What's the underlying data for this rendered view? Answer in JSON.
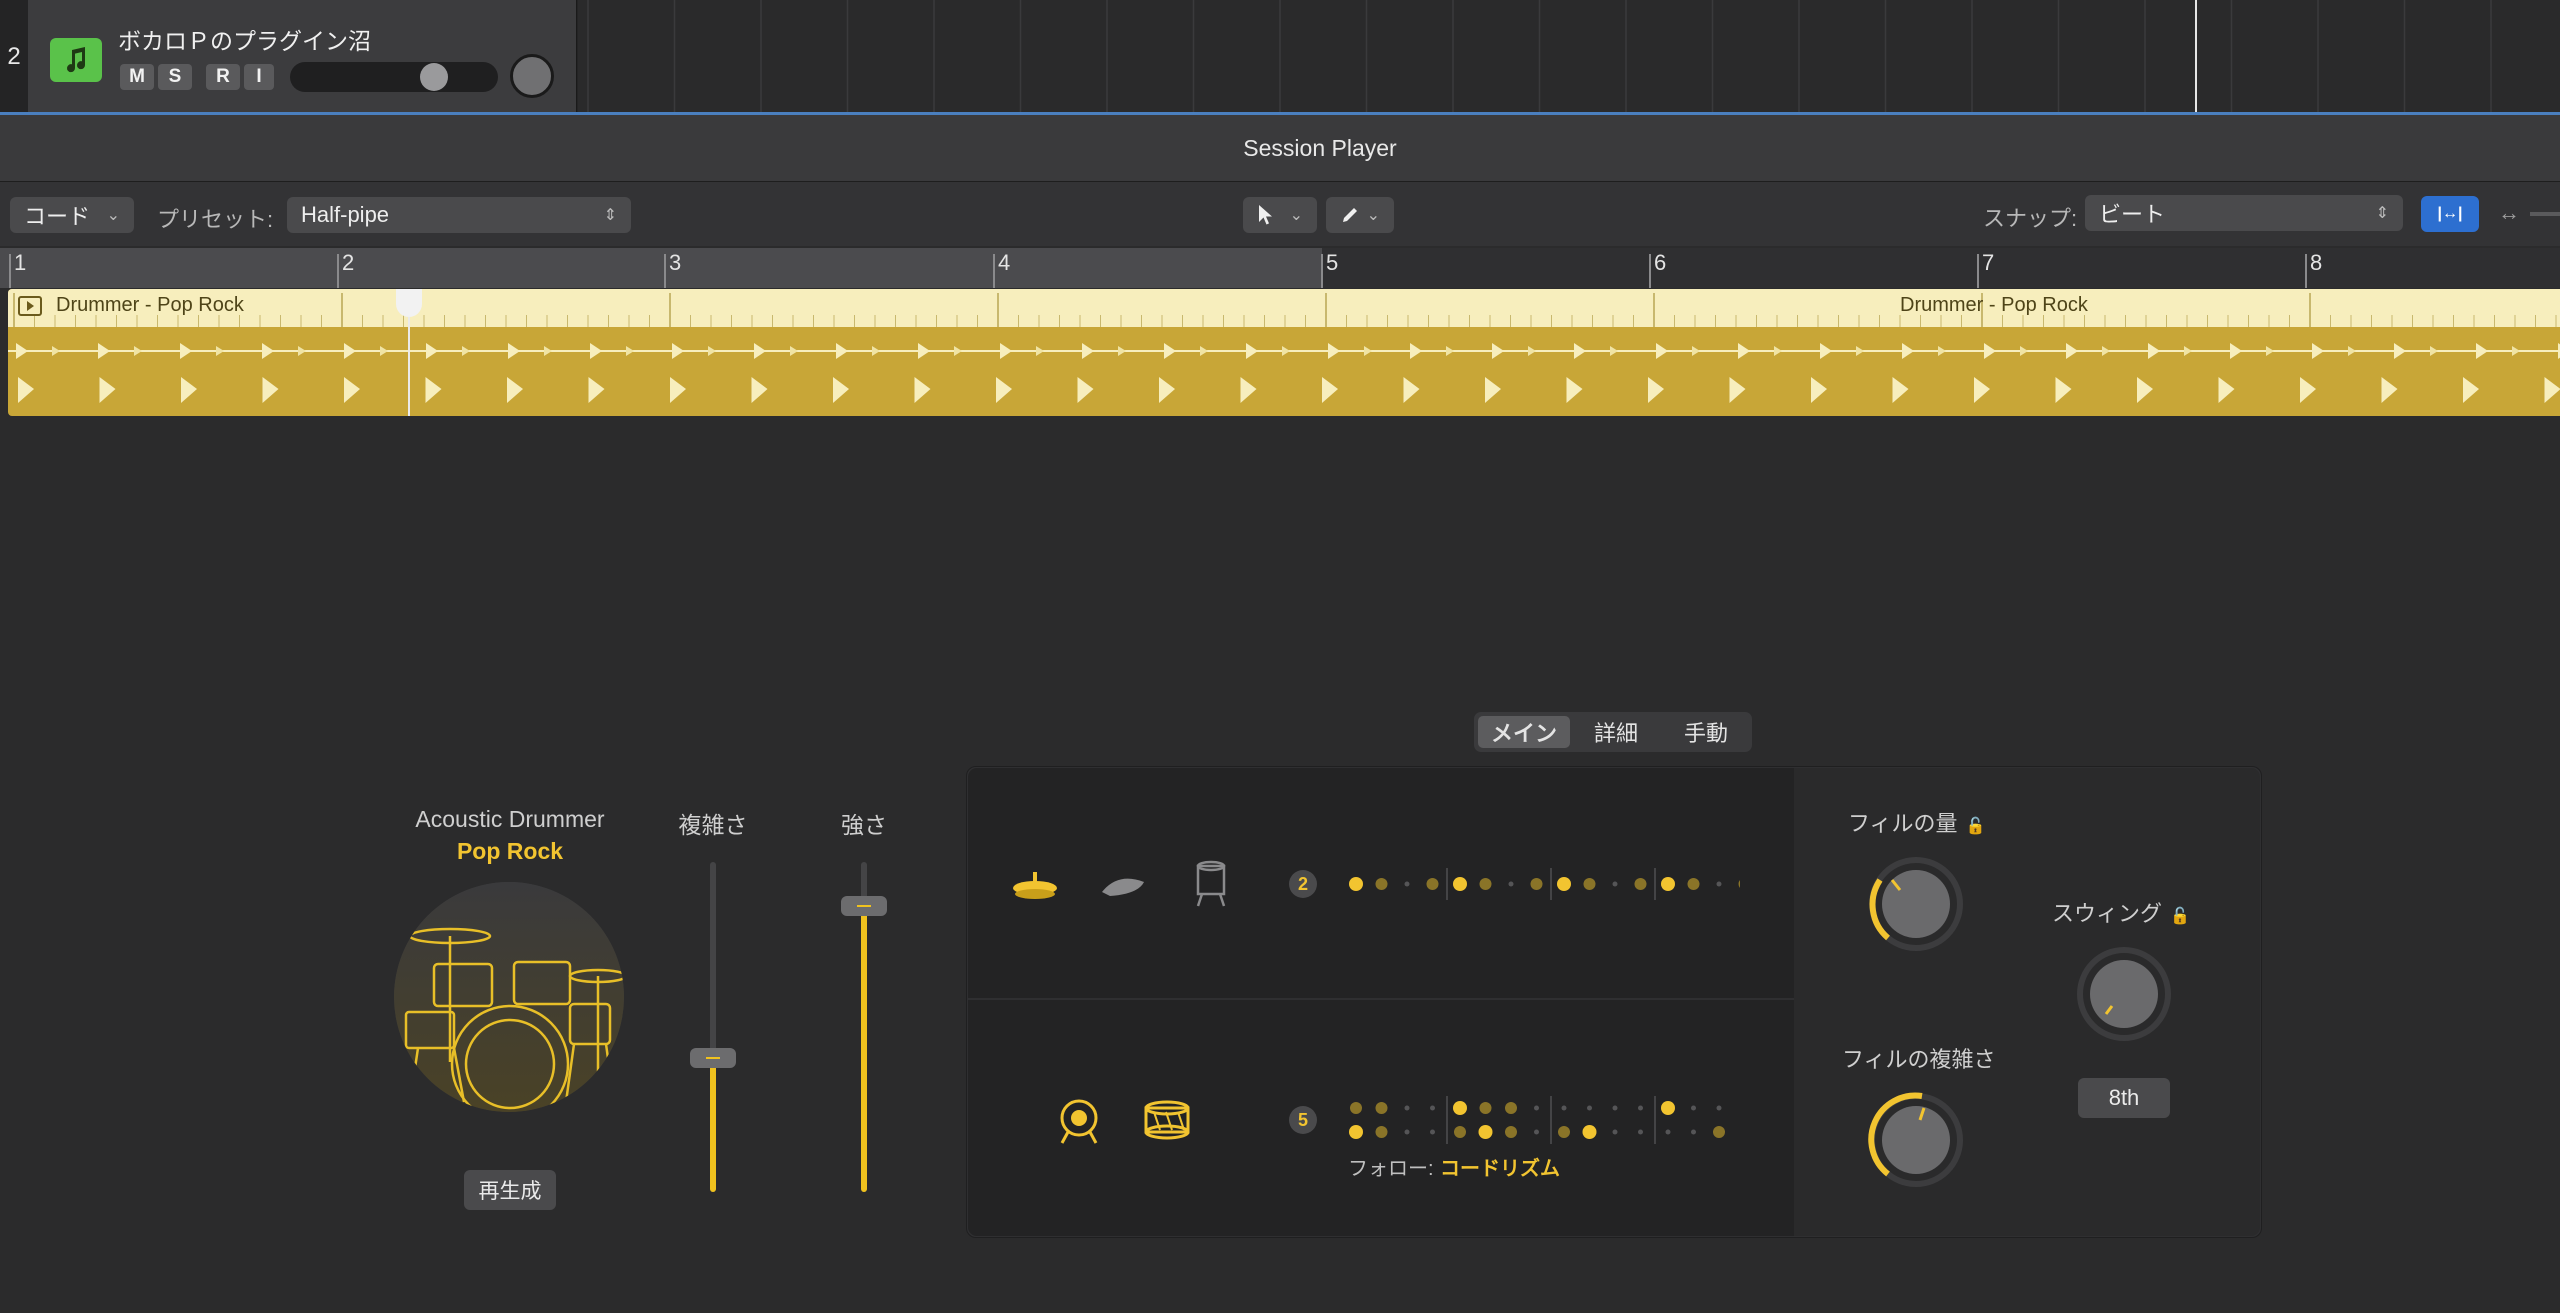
{
  "track": {
    "number": "2",
    "name": "ボカロＰのプラグイン沼",
    "buttons": [
      "M",
      "S",
      "R",
      "I"
    ]
  },
  "session_player": {
    "title": "Session Player"
  },
  "toolbar": {
    "mode_popup": "コード",
    "preset_label": "プリセット:",
    "preset_value": "Half-pipe",
    "snap_label": "スナップ:",
    "snap_value": "ビート"
  },
  "ruler": {
    "bars": [
      "1",
      "2",
      "3",
      "4",
      "5",
      "6",
      "7",
      "8"
    ]
  },
  "region": {
    "name_1": "Drummer - Pop Rock",
    "name_2": "Drummer - Pop Rock"
  },
  "tabs": [
    "メイン",
    "詳細",
    "手動"
  ],
  "drummer": {
    "name": "Acoustic Drummer",
    "genre": "Pop Rock",
    "regenerate_label": "再生成"
  },
  "sliders": {
    "complexity_label": "複雑さ",
    "complexity_value": 0.41,
    "intensity_label": "強さ",
    "intensity_value": 0.87
  },
  "patterns": {
    "top_lane_value": "2",
    "bottom_lane_value": "5",
    "follow_label": "フォロー:",
    "follow_value": "コードリズム"
  },
  "knobs": {
    "fill_amount_label": "フィルの量",
    "fill_complexity_label": "フィルの複雑さ",
    "swing_label": "スウィング",
    "swing_value": "8th"
  },
  "colors": {
    "accent_yellow": "#f2c430",
    "region_header": "#f7eebd",
    "region_body": "#c8a637",
    "link_button": "#2d6fd0",
    "track_icon": "#5ac24a"
  },
  "icons": {
    "track": "music-note-icon",
    "cymbal": "hihat-icon",
    "shaker": "shaker-icon",
    "tom": "tom-icon",
    "kick": "kick-drum-icon",
    "snare": "snare-drum-icon",
    "lock": "unlock-icon"
  }
}
